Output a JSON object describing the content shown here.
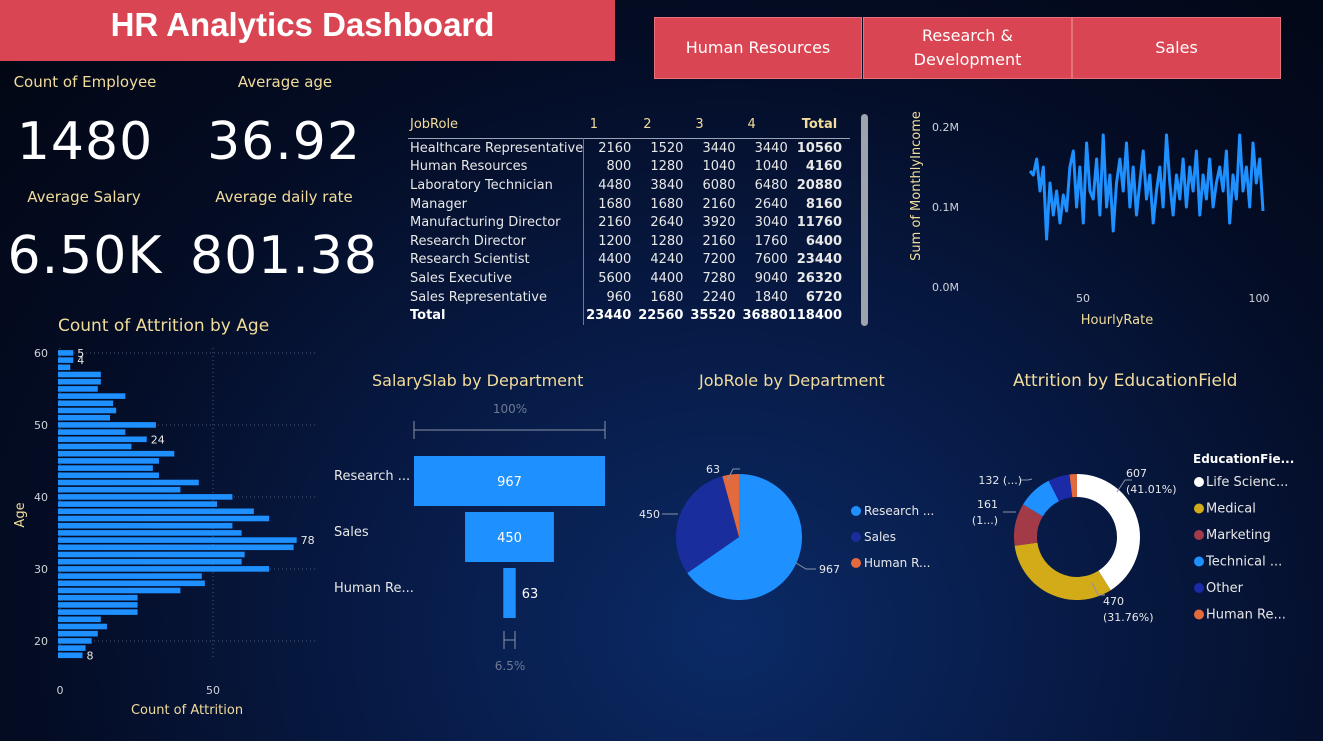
{
  "title": "HR Analytics Dashboard",
  "departments": [
    "Human Resources",
    "Research & Development",
    "Sales"
  ],
  "kpis": {
    "count_label": "Count of Employee",
    "count_value": "1480",
    "age_label": "Average age",
    "age_value": "36.92",
    "salary_label": "Average Salary",
    "salary_value": "6.50K",
    "rate_label": "Average daily rate",
    "rate_value": "801.38"
  },
  "colors": {
    "accent": "#d94552",
    "blue": "#1e90ff",
    "darkblue": "#1a2d9c",
    "orange": "#e36a3c",
    "white": "#ffffff",
    "yellow": "#d3aa18",
    "red": "#a33a48",
    "purple": "#1b2aa6",
    "gold_text": "#f2dc9c"
  },
  "matrix": {
    "headers": [
      "JobRole",
      "1",
      "2",
      "3",
      "4",
      "Total"
    ],
    "rows": [
      [
        "Healthcare Representative",
        "2160",
        "1520",
        "3440",
        "3440",
        "10560"
      ],
      [
        "Human Resources",
        "800",
        "1280",
        "1040",
        "1040",
        "4160"
      ],
      [
        "Laboratory Technician",
        "4480",
        "3840",
        "6080",
        "6480",
        "20880"
      ],
      [
        "Manager",
        "1680",
        "1680",
        "2160",
        "2640",
        "8160"
      ],
      [
        "Manufacturing Director",
        "2160",
        "2640",
        "3920",
        "3040",
        "11760"
      ],
      [
        "Research Director",
        "1200",
        "1280",
        "2160",
        "1760",
        "6400"
      ],
      [
        "Research Scientist",
        "4400",
        "4240",
        "7200",
        "7600",
        "23440"
      ],
      [
        "Sales Executive",
        "5600",
        "4400",
        "7280",
        "9040",
        "26320"
      ],
      [
        "Sales Representative",
        "960",
        "1680",
        "2240",
        "1840",
        "6720"
      ]
    ],
    "total": [
      "Total",
      "23440",
      "22560",
      "35520",
      "36880",
      "118400"
    ]
  },
  "chart_data": [
    {
      "type": "line",
      "ylabel": "Sum of MonthlyIncome",
      "xlabel": "HourlyRate",
      "x_ticks": [
        "50",
        "100"
      ],
      "y_ticks": [
        "0.0M",
        "0.1M",
        "0.2M"
      ],
      "xlim": [
        30,
        100
      ],
      "ylim": [
        0,
        200000
      ],
      "x": [
        30,
        31,
        32,
        33,
        34,
        35,
        36,
        37,
        38,
        39,
        40,
        41,
        42,
        43,
        44,
        45,
        46,
        47,
        48,
        49,
        50,
        51,
        52,
        53,
        54,
        55,
        56,
        57,
        58,
        59,
        60,
        61,
        62,
        63,
        64,
        65,
        66,
        67,
        68,
        69,
        70,
        71,
        72,
        73,
        74,
        75,
        76,
        77,
        78,
        79,
        80,
        81,
        82,
        83,
        84,
        85,
        86,
        87,
        88,
        89,
        90,
        91,
        92,
        93,
        94,
        95,
        96,
        97,
        98,
        99,
        100
      ],
      "values": [
        145000,
        140000,
        160000,
        120000,
        150000,
        60000,
        130000,
        90000,
        120000,
        80000,
        115000,
        95000,
        150000,
        170000,
        100000,
        150000,
        80000,
        180000,
        120000,
        110000,
        160000,
        90000,
        190000,
        100000,
        140000,
        70000,
        130000,
        160000,
        120000,
        180000,
        100000,
        150000,
        90000,
        130000,
        170000,
        110000,
        140000,
        80000,
        120000,
        150000,
        100000,
        190000,
        130000,
        90000,
        140000,
        110000,
        160000,
        100000,
        150000,
        120000,
        170000,
        90000,
        140000,
        110000,
        160000,
        100000,
        130000,
        150000,
        120000,
        170000,
        80000,
        140000,
        110000,
        190000,
        120000,
        150000,
        100000,
        180000,
        130000,
        160000,
        95000
      ]
    },
    {
      "type": "bar",
      "title": "Count of Attrition by Age",
      "xlabel": "Count of Attrition",
      "ylabel": "Age",
      "orientation": "horizontal",
      "x_ticks": [
        "0",
        "50"
      ],
      "y_ticks": [
        "20",
        "30",
        "40",
        "50",
        "60"
      ],
      "xlim": [
        0,
        90
      ],
      "ages": [
        18,
        19,
        20,
        21,
        22,
        23,
        24,
        25,
        26,
        27,
        28,
        29,
        30,
        31,
        32,
        33,
        34,
        35,
        36,
        37,
        38,
        39,
        40,
        41,
        42,
        43,
        44,
        45,
        46,
        47,
        48,
        49,
        50,
        51,
        52,
        53,
        54,
        55,
        56,
        57,
        58,
        59,
        60
      ],
      "values": [
        8,
        9,
        11,
        13,
        16,
        14,
        26,
        26,
        26,
        40,
        48,
        47,
        69,
        60,
        61,
        77,
        78,
        60,
        57,
        69,
        64,
        52,
        57,
        40,
        46,
        33,
        31,
        33,
        38,
        24,
        29,
        22,
        32,
        17,
        19,
        18,
        22,
        13,
        14,
        14,
        4,
        5,
        5
      ],
      "data_labels": {
        "60": "5",
        "59": "4",
        "48": "24",
        "34": "78",
        "18": "8"
      }
    },
    {
      "type": "funnel",
      "title": "SalarySlab by Department",
      "categories": [
        "Research ...",
        "Sales",
        "Human Re..."
      ],
      "values": [
        967,
        450,
        63
      ],
      "top_percent": "100%",
      "bottom_percent": "6.5%"
    },
    {
      "type": "pie",
      "title": "JobRole by Department",
      "categories": [
        "Research ...",
        "Sales",
        "Human R..."
      ],
      "values": [
        967,
        450,
        63
      ],
      "colors": [
        "#1e90ff",
        "#1a2d9c",
        "#e36a3c"
      ]
    },
    {
      "type": "pie",
      "subtype": "donut",
      "title": "Attrition by EducationField",
      "legend_title": "EducationFie...",
      "categories": [
        "Life Scienc...",
        "Medical",
        "Marketing",
        "Technical ...",
        "Other",
        "Human Re..."
      ],
      "values": [
        607,
        470,
        161,
        132,
        82,
        28
      ],
      "colors": [
        "#ffffff",
        "#d3aa18",
        "#a33a48",
        "#1e90ff",
        "#1b2aa6",
        "#e36a3c"
      ],
      "labels": {
        "life": [
          "607",
          "(41.01%)"
        ],
        "medical": [
          "470",
          "(31.76%)"
        ],
        "marketing": [
          "161",
          "(1...)"
        ],
        "technical": "132 (...)"
      }
    }
  ]
}
